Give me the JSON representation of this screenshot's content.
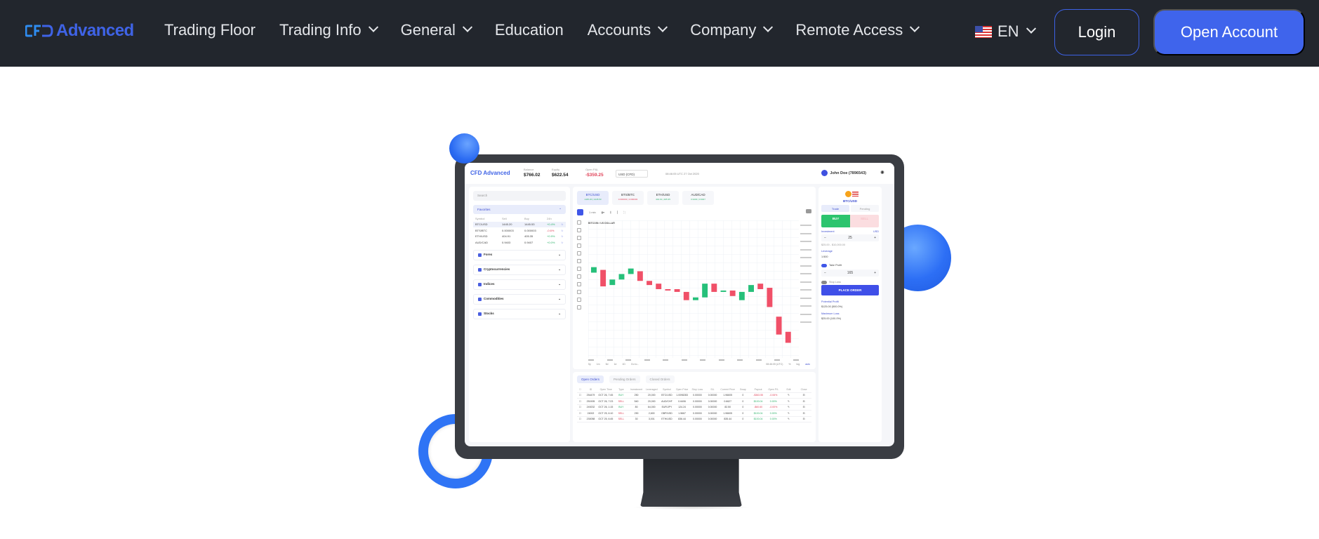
{
  "navbar": {
    "logo_mark": "CFD",
    "logo_text": "Advanced",
    "items": [
      {
        "label": "Trading Floor",
        "dropdown": false
      },
      {
        "label": "Trading Info",
        "dropdown": true
      },
      {
        "label": "General",
        "dropdown": true
      },
      {
        "label": "Education",
        "dropdown": false
      },
      {
        "label": "Accounts",
        "dropdown": true
      },
      {
        "label": "Company",
        "dropdown": true
      },
      {
        "label": "Remote Access",
        "dropdown": true
      }
    ],
    "language": {
      "label": "EN",
      "flag": "us-flag-icon"
    },
    "login_label": "Login",
    "open_account_label": "Open Account",
    "colors": {
      "background": "#22262d",
      "accent": "#3f64ec"
    }
  },
  "app_preview": {
    "logo": "CFD Advanced",
    "stats": [
      {
        "label": "Balance",
        "value": "$766.02"
      },
      {
        "label": "Equity",
        "value": "$622.54"
      },
      {
        "label": "Open P&L",
        "value": "-$359.25"
      }
    ],
    "currency": "USD (CFD)",
    "clock": "08:46:05 UTC 27 Oct 2020",
    "user": "John Doe (7896543)",
    "search_placeholder": "Search",
    "favorites_label": "Favorites",
    "fav_headers": [
      "Symbol",
      "Sell",
      "Buy",
      "24h"
    ],
    "favorites": [
      {
        "symbol": "BTC/USD",
        "sell": "1445.20",
        "buy": "1445.53",
        "change": "+0.4%",
        "dir": "up"
      },
      {
        "symbol": "BTS/BTC",
        "sell": "0.000003",
        "buy": "0.000003",
        "change": "-0.6%",
        "dir": "down"
      },
      {
        "symbol": "ETH/USD",
        "sell": "404.91",
        "buy": "405.35",
        "change": "+0.9%",
        "dir": "up"
      },
      {
        "symbol": "AUD/CAD",
        "sell": "0.9403",
        "buy": "0.9407",
        "change": "+0.0%",
        "dir": "up"
      }
    ],
    "categories": [
      "Forex",
      "Cryptocurrencies",
      "Indices",
      "Commodities",
      "Stocks"
    ],
    "pairs": [
      {
        "label": "BTC/USD",
        "sub": "1445.20 | 1445.53"
      },
      {
        "label": "BTS/BTC",
        "sub": "0.000003 | 0.000003"
      },
      {
        "label": "ETH/USD",
        "sub": "404.91 | 405.35"
      },
      {
        "label": "AUD/CAD",
        "sub": "0.9403 | 0.9407"
      }
    ],
    "timeframe": "1 min",
    "chart_title": "BITCOIN / US DOLLAR",
    "range_buttons": [
      "5y",
      "1m",
      "5d",
      "1d",
      "1D",
      "Go to..."
    ],
    "chart_footer": [
      "08:46:05 (UTC)",
      "%",
      "log",
      "auto"
    ],
    "order_tabs": [
      "Open Orders",
      "Pending Orders",
      "Closed Orders"
    ],
    "order_headers": [
      "ID",
      "Open Time",
      "Type",
      "Investment",
      "Leveraged",
      "Symbol",
      "Open Price",
      "Stop Loss",
      "S/L",
      "Current Price",
      "Swap",
      "Payout",
      "Open P/L",
      "Edit",
      "Close"
    ],
    "orders": [
      [
        "254479",
        "OCT 26, 7:45 AM",
        "BUY",
        "250",
        "20,000",
        "BTC/USD",
        "1.0098283",
        "0.00000",
        "0.00000",
        "1.96605",
        "0",
        "-$363.55",
        "-0.06%"
      ],
      [
        "251905",
        "OCT 26, 7:23 AM",
        "SELL",
        "540",
        "20,000",
        "AUD/CHF",
        "0.6406",
        "0.00000",
        "0.00000",
        "0.6627",
        "0",
        "$100.04",
        "0.00%"
      ],
      [
        "249232",
        "OCT 26, 1:15 AM",
        "BUY",
        "80",
        "64,000",
        "EUR/JPY",
        "124.24",
        "0.00000",
        "0.00000",
        "82.50",
        "0",
        "-$60.60",
        "-0.00%"
      ],
      [
        "24002",
        "OCT 25, 6:10 PM",
        "SELL",
        "290",
        "2,600",
        "GBP/USD",
        "1.5667",
        "0.00000",
        "0.00000",
        "1.96605",
        "0",
        "$100.04",
        "0.00%"
      ],
      [
        "230058",
        "OCT 25, 6:45 PM",
        "SELL",
        "30",
        "3,001",
        "ETH/USD",
        "836.44",
        "0.00000",
        "0.00000",
        "835.44",
        "0",
        "$100.04",
        "0.00%"
      ]
    ],
    "trade": {
      "symbol": "BTC/USD",
      "tabs": [
        "Trade",
        "Pending"
      ],
      "buy_label": "BUY",
      "sell_label": "SELL",
      "investment_label": "Investment",
      "investment_currency": "USD",
      "investment_value": "25",
      "investment_range": "$25.00 - $10,000.00",
      "leverage_label": "Leverage",
      "leverage_value": "1:500",
      "take_profit_label": "Take Profit",
      "take_profit_value": "165",
      "stop_loss_label": "Stop Loss",
      "place_order_label": "PLACE ORDER",
      "potential_profit_label": "Potential Profit",
      "potential_profit_value": "$125.00 (500.0%)",
      "max_loss_label": "Maximum Loss",
      "max_loss_value": "$25.00 (100.0%)"
    },
    "candles": [
      {
        "o": 62,
        "c": 66
      },
      {
        "o": 64,
        "c": 52
      },
      {
        "o": 53,
        "c": 57
      },
      {
        "o": 57,
        "c": 61
      },
      {
        "o": 61,
        "c": 65
      },
      {
        "o": 63,
        "c": 56
      },
      {
        "o": 56,
        "c": 53
      },
      {
        "o": 54,
        "c": 50
      },
      {
        "o": 50,
        "c": 49
      },
      {
        "o": 50,
        "c": 48
      },
      {
        "o": 48,
        "c": 42
      },
      {
        "o": 42,
        "c": 44
      },
      {
        "o": 44,
        "c": 54
      },
      {
        "o": 54,
        "c": 48
      },
      {
        "o": 48,
        "c": 49
      },
      {
        "o": 49,
        "c": 45
      },
      {
        "o": 42,
        "c": 48
      },
      {
        "o": 48,
        "c": 53
      },
      {
        "o": 54,
        "c": 50
      },
      {
        "o": 51,
        "c": 37
      },
      {
        "o": 30,
        "c": 17
      },
      {
        "o": 19,
        "c": 11
      }
    ]
  }
}
